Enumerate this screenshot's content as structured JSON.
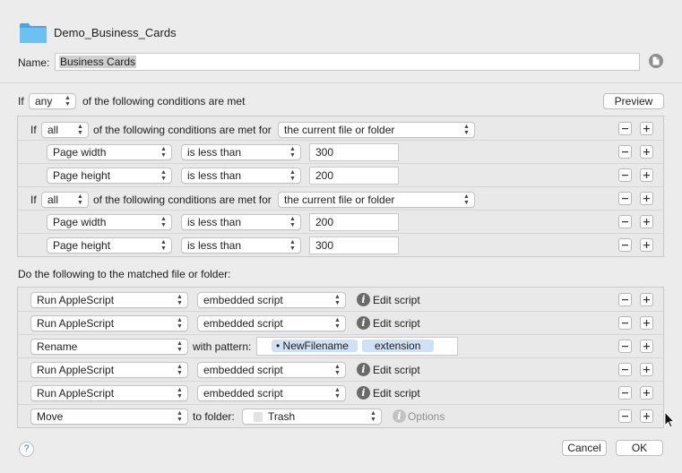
{
  "header": {
    "title": "Demo_Business_Cards",
    "name_label": "Name:",
    "name_value": "Business Cards",
    "folder_icon": "folder-icon",
    "doc_icon": "document-icon"
  },
  "conditions": {
    "if_label": "If",
    "match": "any",
    "suffix": "of the following conditions are met",
    "preview_label": "Preview",
    "groups": [
      {
        "if_label": "If",
        "match": "all",
        "text": "of the following conditions are met for",
        "target": "the current file or folder",
        "rows": [
          {
            "attr": "Page width",
            "op": "is less than",
            "value": "300"
          },
          {
            "attr": "Page height",
            "op": "is less than",
            "value": "200"
          }
        ]
      },
      {
        "if_label": "If",
        "match": "all",
        "text": "of the following conditions are met for",
        "target": "the current file or folder",
        "rows": [
          {
            "attr": "Page width",
            "op": "is less than",
            "value": "200"
          },
          {
            "attr": "Page height",
            "op": "is less than",
            "value": "300"
          }
        ]
      }
    ]
  },
  "actions": {
    "heading": "Do the following to the matched file or folder:",
    "rows": [
      {
        "action": "Run AppleScript",
        "param": "embedded script",
        "link": "Edit script"
      },
      {
        "action": "Run AppleScript",
        "param": "embedded script",
        "link": "Edit script"
      },
      {
        "action": "Rename",
        "with_label": "with pattern:",
        "tokens": [
          "NewFilename",
          "extension"
        ]
      },
      {
        "action": "Run AppleScript",
        "param": "embedded script",
        "link": "Edit script"
      },
      {
        "action": "Run AppleScript",
        "param": "embedded script",
        "link": "Edit script"
      },
      {
        "action": "Move",
        "with_label": "to folder:",
        "param": "Trash",
        "link": "Options"
      }
    ]
  },
  "footer": {
    "help": "?",
    "cancel": "Cancel",
    "ok": "OK"
  },
  "colors": {
    "background": "#ececec",
    "token": "#cfe1f5",
    "help_accent": "#2a7de1",
    "folder": "#5ab2ea"
  }
}
